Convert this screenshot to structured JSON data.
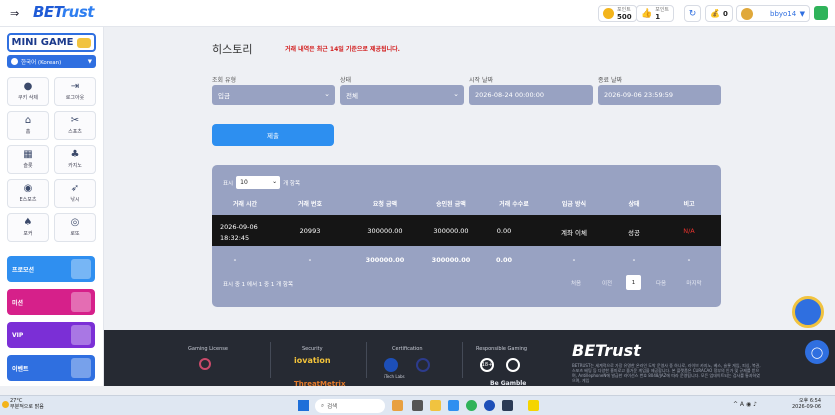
{
  "header": {
    "logo_text": "BET",
    "logo_accent": "rust",
    "balance1_label": "포인트",
    "balance1_value": "500",
    "balance2_label": "포인트",
    "balance2_value": "1",
    "balance3_value": "0",
    "username": "bbyo14"
  },
  "sidebar": {
    "mini_game": "MINI GAME",
    "language": "한국어 (Korean)",
    "buttons": [
      {
        "label": "쿠키 삭제",
        "icon": "cookie-icon"
      },
      {
        "label": "로그아웃",
        "icon": "logout-icon"
      },
      {
        "label": "홈",
        "icon": "home-icon"
      },
      {
        "label": "스포츠",
        "icon": "sports-icon"
      },
      {
        "label": "슬롯",
        "icon": "slot-icon"
      },
      {
        "label": "카지노",
        "icon": "casino-icon"
      },
      {
        "label": "E스포츠",
        "icon": "gamepad-icon"
      },
      {
        "label": "낚시",
        "icon": "fishing-icon"
      },
      {
        "label": "포커",
        "icon": "poker-icon"
      },
      {
        "label": "로또",
        "icon": "lotto-icon"
      }
    ],
    "promos": [
      {
        "label": "프로모션",
        "color": "#2f8ff0"
      },
      {
        "label": "미션",
        "color": "#d6208a"
      },
      {
        "label": "VIP",
        "color": "#7b2fd6"
      },
      {
        "label": "이벤트",
        "color": "#2f6fe0"
      }
    ]
  },
  "main": {
    "title": "히스토리",
    "notice": "거래 내역은 최근 14일 기준으로 제공됩니다.",
    "filters": {
      "type_label": "조회 유형",
      "type_value": "입금",
      "status_label": "상태",
      "status_value": "전체",
      "start_label": "시작 날짜",
      "start_value": "2026-08-24 00:00:00",
      "end_label": "종료 날짜",
      "end_value": "2026-09-06 23:59:59"
    },
    "submit": "제출",
    "table": {
      "show_prefix": "표시",
      "show_value": "10",
      "show_suffix": "개 항목",
      "headers": [
        "거래 시간",
        "거래 번호",
        "요청 금액",
        "승인된 금액",
        "거래 수수료",
        "입금 방식",
        "상태",
        "비고"
      ],
      "row": {
        "time_date": "2026-09-06",
        "time_clock": "18:32:45",
        "number": "20993",
        "requested": "300000.00",
        "approved": "300000.00",
        "fee": "0.00",
        "method": "계좌 이체",
        "status": "성공",
        "note": "N/A"
      },
      "totals": [
        "-",
        "-",
        "300000.00",
        "300000.00",
        "0.00",
        "-",
        "-",
        "-"
      ],
      "info": "표시 중 1 에서 1 중 1 개 항목",
      "pagination": {
        "first": "처음",
        "prev": "이전",
        "current": "1",
        "next": "다음",
        "last": "마지막"
      }
    }
  },
  "footer": {
    "gaming_license": "Gaming License",
    "security": "Security",
    "security_brand1": "iovation",
    "security_brand2": "ThreatMetrix",
    "certification": "Certification",
    "cert_brand": "iTech Labs",
    "responsible": "Responsible Gaming",
    "resp_18": "18+",
    "resp_brand": "Be Gamble",
    "brand_logo": "BETrust",
    "brand_text": "BETRUST는 세계적으로 가장 유명한 온라인 도박 운영사 중 하나로, 라이브 카지노, 베스, 슬롯 게임, 피싱, 복권, 스포츠 베팅 등 다양한 흥미로고 즐거운 게임을 제공합니다. 본 플랫폼은 CURACAO 정부의 인가 및 규제를 받으며, AntillephoneN에 발급한 라이선스 번호 8048/JAZ에 따라 운영됩니다. 모든 업데이트되는 검사를 통과하였으며, 게임"
  },
  "taskbar": {
    "temp": "27°C",
    "weather": "부분적으로 맑음",
    "search": "검색",
    "time": "오후 6:54",
    "date": "2026-09-06"
  }
}
